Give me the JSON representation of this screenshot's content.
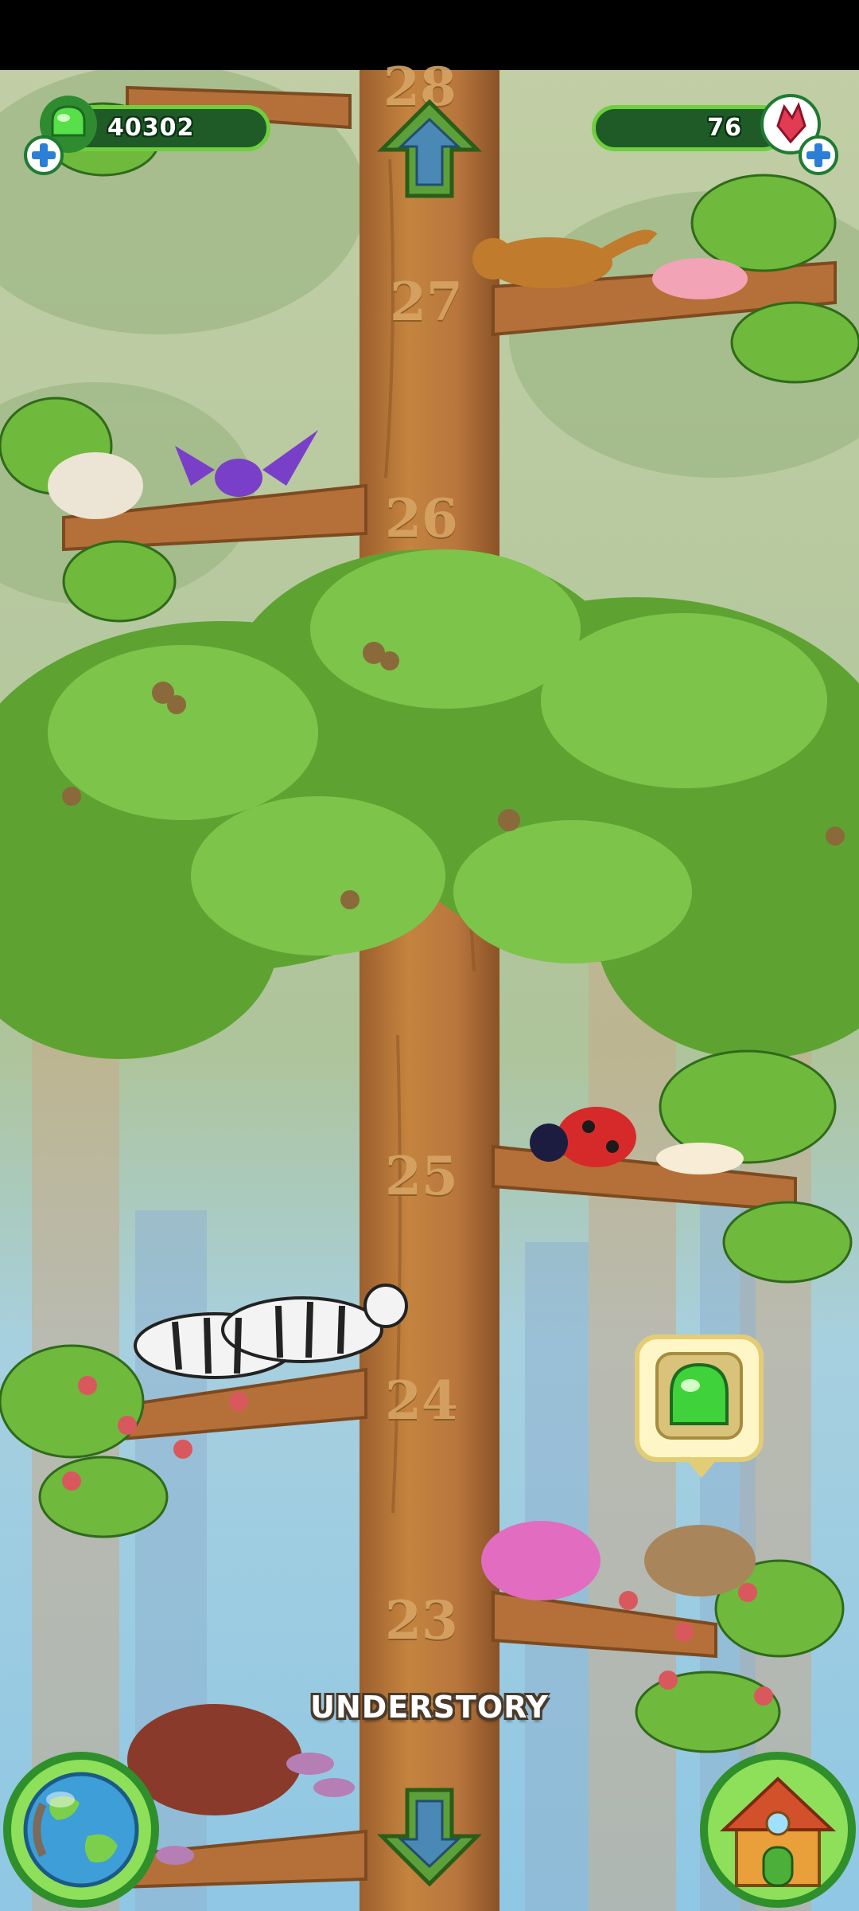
{
  "hud": {
    "gems_count": "40302",
    "rubies_count": "76"
  },
  "tree": {
    "levels": [
      "28",
      "27",
      "26",
      "25",
      "24",
      "23"
    ]
  },
  "area": {
    "name": "UNDERSTORY"
  },
  "icons": {
    "gem": "green-gem-icon",
    "ruby": "red-crystal-icon",
    "add": "plus-icon",
    "up": "arrow-up-icon",
    "down": "arrow-down-icon",
    "map": "globe-icon",
    "home": "house-icon"
  },
  "colors": {
    "hud_bar": "#1e5b27",
    "hud_border": "#6fcf3e",
    "trunk": "#b8763d",
    "foliage": "#6cb83a",
    "level_label": "#d6a464"
  }
}
